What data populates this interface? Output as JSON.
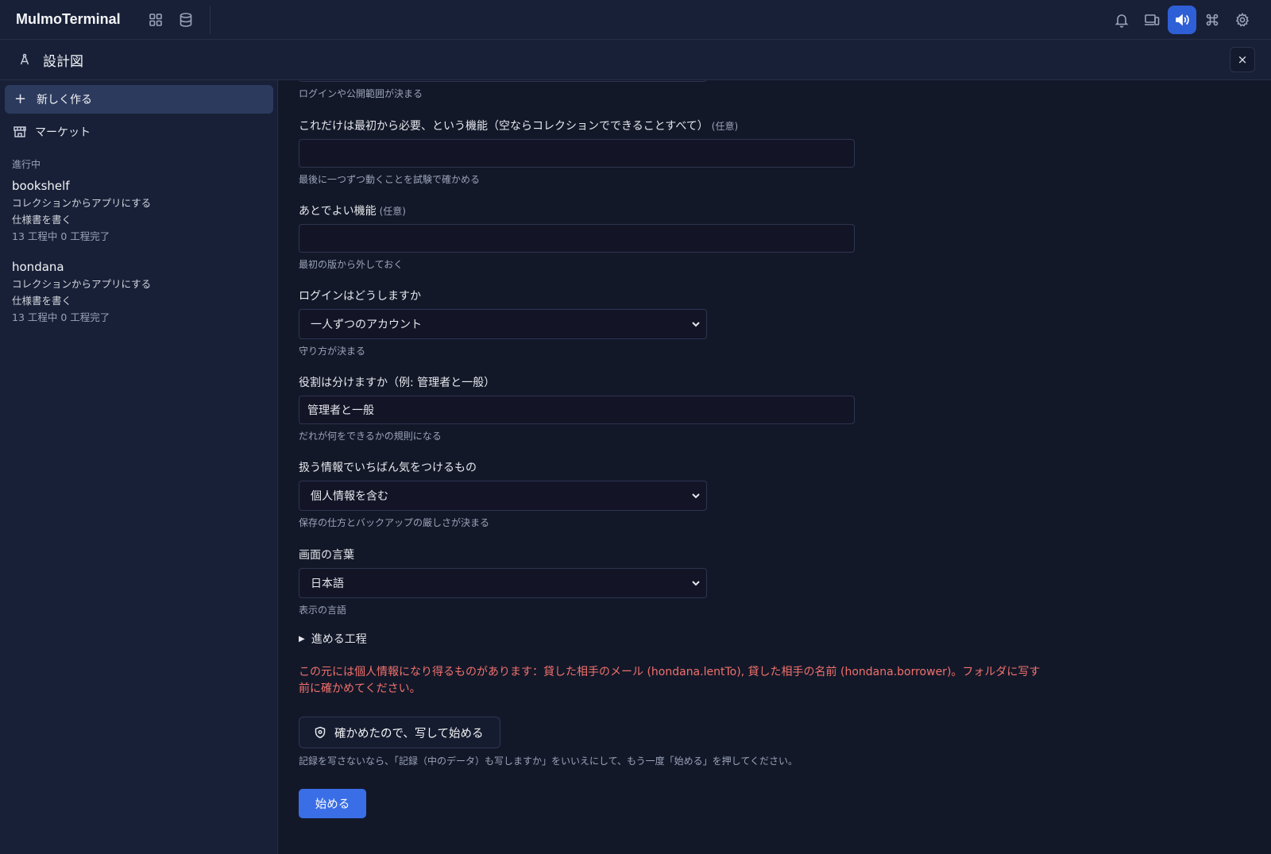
{
  "app": {
    "title": "MulmoTerminal"
  },
  "topbar": {
    "left_icons": [
      "grid-icon",
      "database-icon"
    ],
    "right_icons": [
      "bell-icon",
      "devices-icon",
      "speaker-icon",
      "command-icon",
      "gear-icon"
    ],
    "active_icon": "speaker-icon",
    "accent_color": "#2f5fd6"
  },
  "subheader": {
    "title": "設計図",
    "icon": "compass-icon",
    "close": "×"
  },
  "sidebar": {
    "new_label": "新しく作る",
    "market_label": "マーケット",
    "section_label": "進行中",
    "projects": [
      {
        "name": "bookshelf",
        "line1": "コレクションからアプリにする",
        "line2": "仕様書を書く",
        "progress": "13 工程中 0 工程完了"
      },
      {
        "name": "hondana",
        "line1": "コレクションからアプリにする",
        "line2": "仕様書を書く",
        "progress": "13 工程中 0 工程完了"
      }
    ]
  },
  "form": {
    "top_help": "ログインや公開範囲が決まる",
    "f_required": {
      "label": "これだけは最初から必要、という機能（空ならコレクションでできることすべて）",
      "optional": "(任意)",
      "value": "",
      "help": "最後に一つずつ動くことを試験で確かめる"
    },
    "f_later": {
      "label": "あとでよい機能",
      "optional": "(任意)",
      "value": "",
      "help": "最初の版から外しておく"
    },
    "f_login": {
      "label": "ログインはどうしますか",
      "value": "一人ずつのアカウント",
      "help": "守り方が決まる"
    },
    "f_roles": {
      "label": "役割は分けますか（例: 管理者と一般）",
      "value": "管理者と一般",
      "help": "だれが何をできるかの規則になる"
    },
    "f_sensitive": {
      "label": "扱う情報でいちばん気をつけるもの",
      "value": "個人情報を含む",
      "help": "保存の仕方とバックアップの厳しさが決まる"
    },
    "f_lang": {
      "label": "画面の言葉",
      "value": "日本語",
      "help": "表示の言語"
    },
    "details_label": "進める工程",
    "warning": "この元には個人情報になり得るものがあります：貸した相手のメール (hondana.lentTo), 貸した相手の名前 (hondana.borrower)。フォルダに写す前に確かめてください。",
    "warning_color": "#f0716b",
    "confirm_label": "確かめたので、写して始める",
    "note": "記録を写さないなら、「記録（中のデータ）も写しますか」をいいえにして、もう一度「始める」を押してください。",
    "start_label": "始める",
    "start_color": "#3a6ee6"
  }
}
